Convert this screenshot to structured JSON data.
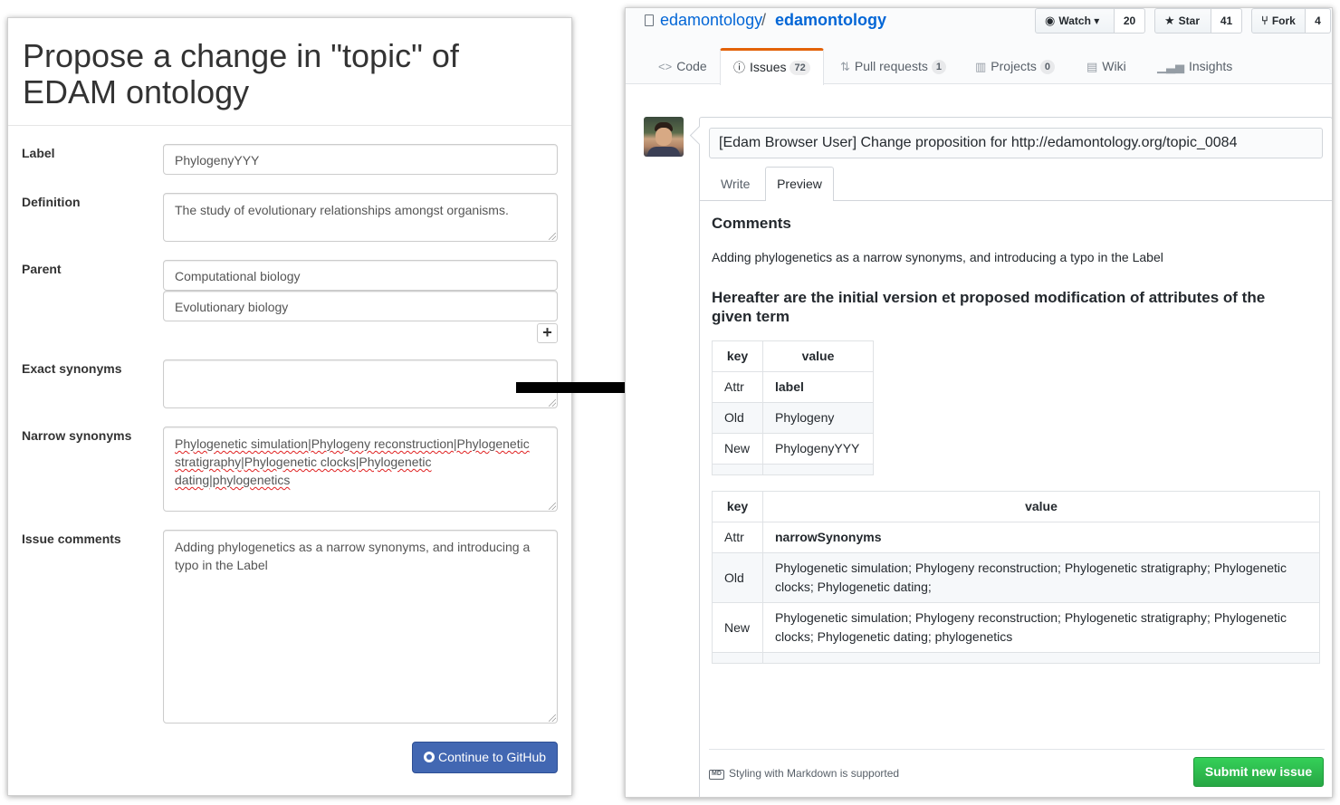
{
  "left": {
    "title": "Propose a change in \"topic\" of EDAM ontology",
    "fields": {
      "label_caption": "Label",
      "label_value": "PhylogenyYYY",
      "definition_caption": "Definition",
      "definition_value": "The study of evolutionary relationships amongst organisms.",
      "parent_caption": "Parent",
      "parent_values": [
        "Computational biology",
        "Evolutionary biology"
      ],
      "add_symbol": "+",
      "exact_caption": "Exact synonyms",
      "exact_value": "",
      "narrow_caption": "Narrow synonyms",
      "narrow_value": "Phylogenetic simulation|Phylogeny reconstruction|Phylogenetic stratigraphy|Phylogenetic clocks|Phylogenetic dating|phylogenetics",
      "comments_caption": "Issue comments",
      "comments_value": "Adding phylogenetics as a narrow synonyms, and introducing a typo in the Label"
    },
    "continue_button": "Continue to GitHub"
  },
  "github": {
    "owner": "edamontology",
    "separator": "/",
    "repo": "edamontology",
    "watch": {
      "label": "Watch",
      "count": "20"
    },
    "star": {
      "label": "Star",
      "count": "41"
    },
    "fork": {
      "label": "Fork",
      "count": "4"
    },
    "tabs": [
      {
        "label": "Code",
        "icon": "code-icon"
      },
      {
        "label": "Issues",
        "count": "72",
        "icon": "issue-icon"
      },
      {
        "label": "Pull requests",
        "count": "1",
        "icon": "pull-request-icon"
      },
      {
        "label": "Projects",
        "count": "0",
        "icon": "project-icon"
      },
      {
        "label": "Wiki",
        "icon": "book-icon"
      },
      {
        "label": "Insights",
        "icon": "graph-icon"
      }
    ],
    "issue_title": "[Edam Browser User] Change proposition for http://edamontology.org/topic_0084",
    "write_tab": "Write",
    "preview_tab": "Preview",
    "preview": {
      "comments_heading": "Comments",
      "comments_text": "Adding phylogenetics as a narrow synonyms, and introducing a typo in the Label",
      "hereafter_heading": "Hereafter are the initial version et proposed modification of attributes of the given term",
      "table1": {
        "headers": [
          "key",
          "value"
        ],
        "rows": [
          [
            "Attr",
            "label"
          ],
          [
            "Old",
            "Phylogeny"
          ],
          [
            "New",
            "PhylogenyYYY"
          ]
        ]
      },
      "table2": {
        "headers": [
          "key",
          "value"
        ],
        "rows": [
          [
            "Attr",
            "narrowSynonyms"
          ],
          [
            "Old",
            "Phylogenetic simulation; Phylogeny reconstruction; Phylogenetic stratigraphy; Phylogenetic clocks; Phylogenetic dating;"
          ],
          [
            "New",
            "Phylogenetic simulation; Phylogeny reconstruction; Phylogenetic stratigraphy; Phylogenetic clocks; Phylogenetic dating; phylogenetics"
          ]
        ]
      }
    },
    "markdown_icon_text": "MD",
    "markdown_note": "Styling with Markdown is supported",
    "submit_button": "Submit new issue",
    "colors": {
      "link": "#0366d6",
      "issues_tab_accent": "#e36209",
      "submit": "#28a745",
      "continue": "#4267b2"
    }
  }
}
